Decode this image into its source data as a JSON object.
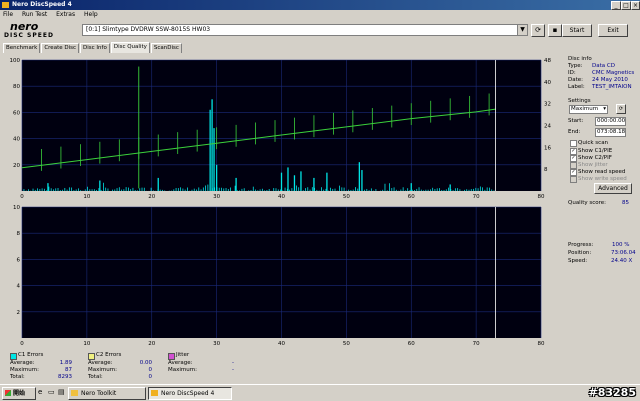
{
  "window": {
    "title": "Nero DiscSpeed 4"
  },
  "menu": [
    "File",
    "Run Test",
    "Extras",
    "Help"
  ],
  "logo": {
    "top": "nero",
    "bottom": "DISC SPEED"
  },
  "drive": {
    "selected": "[0:1]  Slimtype DVDRW SSW-8015S HW03"
  },
  "toolbar": {
    "start_label": "Start",
    "exit_label": "Exit"
  },
  "tabs": [
    "Benchmark",
    "Create Disc",
    "Disc Info",
    "Disc Quality",
    "ScanDisc"
  ],
  "active_tab": "Disc Quality",
  "upper_chart": {
    "y_left_ticks": [
      "100",
      "80",
      "60",
      "40",
      "20"
    ],
    "y_right_ticks": [
      "48",
      "40",
      "32",
      "24",
      "16",
      "8"
    ],
    "x_ticks": [
      "0",
      "10",
      "20",
      "30",
      "40",
      "50",
      "60",
      "70",
      "80"
    ]
  },
  "lower_chart": {
    "y_left_ticks": [
      "10",
      "8",
      "6",
      "4",
      "2"
    ],
    "x_ticks": [
      "0",
      "10",
      "20",
      "30",
      "40",
      "50",
      "60",
      "70",
      "80"
    ]
  },
  "chart_data": {
    "type": "bar",
    "xlim": [
      0,
      80
    ],
    "ylim": [
      0,
      100
    ],
    "y2lim": [
      0,
      48
    ],
    "c1_spikes": [
      {
        "x": 29,
        "y": 62
      },
      {
        "x": 29.3,
        "y": 70
      },
      {
        "x": 29.6,
        "y": 48
      },
      {
        "x": 30,
        "y": 20
      },
      {
        "x": 40,
        "y": 14
      },
      {
        "x": 41,
        "y": 18
      },
      {
        "x": 42,
        "y": 12
      },
      {
        "x": 43,
        "y": 15
      },
      {
        "x": 45,
        "y": 10
      },
      {
        "x": 47,
        "y": 14
      },
      {
        "x": 52,
        "y": 22
      },
      {
        "x": 52.4,
        "y": 16
      },
      {
        "x": 12,
        "y": 8
      },
      {
        "x": 21,
        "y": 10
      },
      {
        "x": 33,
        "y": 10
      },
      {
        "x": 4,
        "y": 6
      },
      {
        "x": 60,
        "y": 6
      },
      {
        "x": 66,
        "y": 5
      }
    ],
    "speed_line": {
      "x": [
        0,
        10,
        20,
        30,
        40,
        50,
        60,
        70,
        73
      ],
      "y": [
        8.5,
        11.5,
        14.5,
        17.5,
        20.5,
        23.5,
        26.5,
        29,
        30
      ]
    },
    "green_spikes_x": [
      3,
      6,
      9,
      12,
      15,
      18,
      21,
      24,
      27,
      30,
      33,
      36,
      39,
      42,
      45,
      48,
      51,
      54,
      57,
      60,
      63,
      66,
      69,
      72
    ],
    "tall_green_spike": {
      "x": 18,
      "y": 95
    },
    "end_marker_x": 73
  },
  "disc_info": {
    "heading": "Disc info",
    "rows": [
      {
        "label": "Type:",
        "value": "Data CD"
      },
      {
        "label": "ID:",
        "value": "CMC Magnetics"
      },
      {
        "label": "Date:",
        "value": "24 May 2010"
      },
      {
        "label": "Label:",
        "value": "TEST_IMTAION"
      }
    ]
  },
  "settings": {
    "heading": "Settings",
    "speed": "Maximum",
    "start_label": "Start:",
    "start_value": "000:00.00",
    "end_label": "End:",
    "end_value": "073:08.18",
    "checks": [
      {
        "label": "Quick scan",
        "checked": false
      },
      {
        "label": "Show C1/PIE",
        "checked": true
      },
      {
        "label": "Show C2/PIF",
        "checked": true
      },
      {
        "label": "Show jitter",
        "checked": false
      },
      {
        "label": "Show read speed",
        "checked": true
      },
      {
        "label": "Show write speed",
        "checked": false
      }
    ],
    "advanced_label": "Advanced"
  },
  "quality": {
    "label": "Quality score:",
    "value": "85"
  },
  "progress": {
    "rows": [
      {
        "label": "Progress:",
        "value": "100 %"
      },
      {
        "label": "Position:",
        "value": "73:06.04"
      },
      {
        "label": "Speed:",
        "value": "24.40 X"
      }
    ]
  },
  "stats": {
    "c1": {
      "heading": "C1 Errors",
      "average_label": "Average:",
      "average": "1.89",
      "maximum_label": "Maximum:",
      "maximum": "87",
      "total_label": "Total:",
      "total": "8293"
    },
    "c2": {
      "heading": "C2 Errors",
      "average_label": "Average:",
      "average": "0.00",
      "maximum_label": "Maximum:",
      "maximum": "0",
      "total_label": "Total:",
      "total": "0"
    },
    "jitter": {
      "heading": "Jitter",
      "average_label": "Average:",
      "average": "-",
      "maximum_label": "Maximum:",
      "maximum": "-"
    }
  },
  "taskbar": {
    "start_label": "開始",
    "items": [
      {
        "label": "Nero Toolkit",
        "active": false
      },
      {
        "label": "Nero DiscSpeed 4",
        "active": true
      }
    ],
    "watermark": "#83285"
  },
  "colors": {
    "c1": "#00e5e5",
    "speed": "#3bd13b",
    "grid": "#1a2a7a",
    "end_marker": "#ffffff"
  }
}
